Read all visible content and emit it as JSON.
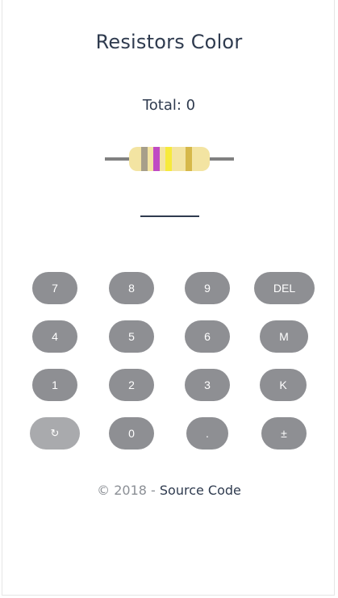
{
  "title": "Resistors Color",
  "total": "Total: 0",
  "display_value": "",
  "resistor": {
    "body_color": "#f3e4a2",
    "lead_color": "#808080",
    "bands": [
      "#a79f8a",
      "#c04bc4",
      "#f7ea3c",
      "#d6b84a"
    ]
  },
  "keypad": {
    "rows": [
      [
        "7",
        "8",
        "9",
        "DEL"
      ],
      [
        "4",
        "5",
        "6",
        "M"
      ],
      [
        "1",
        "2",
        "3",
        "K"
      ],
      [
        "↻",
        "0",
        ".",
        "±"
      ]
    ]
  },
  "footer": {
    "prefix": "© 2018 - ",
    "link": "Source Code"
  }
}
